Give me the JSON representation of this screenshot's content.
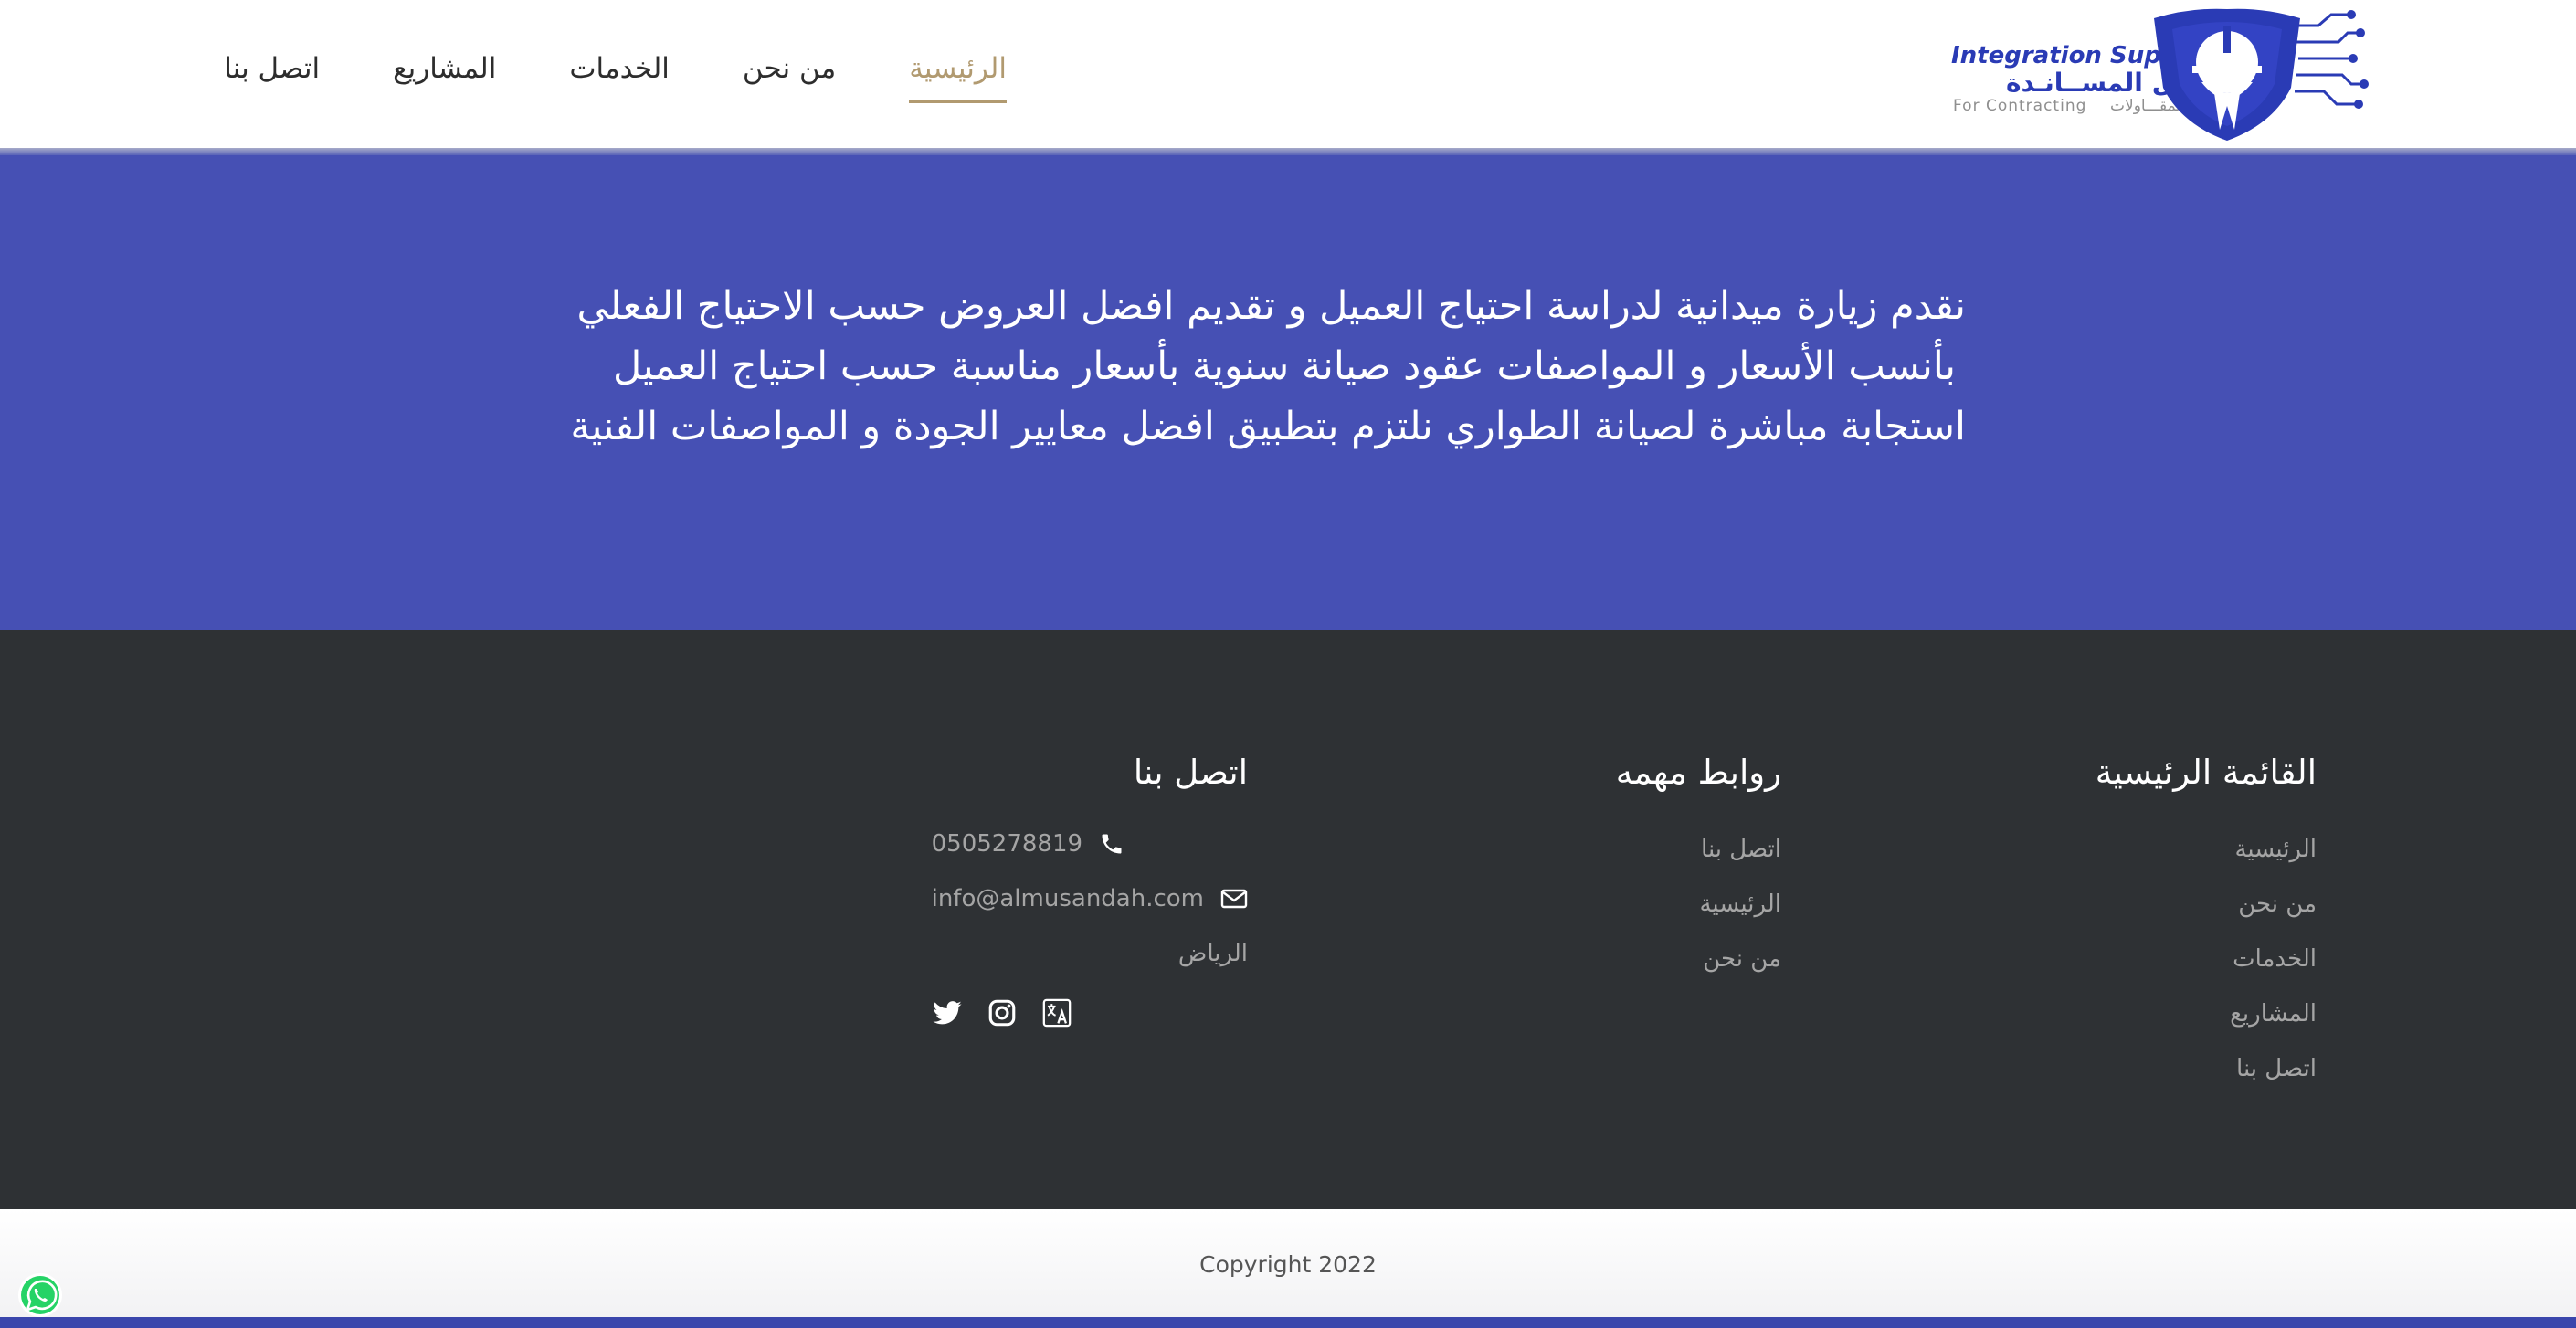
{
  "colors": {
    "header_bg": "#ffffff",
    "nav_active": "#b19a70",
    "hero_bg": "#4650b4",
    "footer_bg": "#2e3134",
    "brand_blue": "#2a3bb5"
  },
  "logo": {
    "text_en": "Integration Supports",
    "text_ar": "تكـامـل المســانـدة",
    "text_sub_en": "For Contracting",
    "text_sub_ar": "للمقـــاولات",
    "icon": "helmet-shield-circuit-logo"
  },
  "nav": {
    "items": [
      {
        "label": "الرئيسية",
        "active": true
      },
      {
        "label": "من نحن",
        "active": false
      },
      {
        "label": "الخدمات",
        "active": false
      },
      {
        "label": "المشاريع",
        "active": false
      },
      {
        "label": "اتصل بنا",
        "active": false
      }
    ]
  },
  "hero": {
    "lines": [
      "نقدم زيارة ميدانية لدراسة احتياج العميل و تقديم افضل العروض حسب الاحتياج الفعلي",
      "بأنسب الأسعار و المواصفات عقود صيانة سنوية بأسعار مناسبة حسب احتياج العميل",
      "استجابة مباشرة لصيانة الطواري نلتزم بتطبيق افضل معايير الجودة و المواصفات الفنية"
    ]
  },
  "footer": {
    "main_menu": {
      "title": "القائمة الرئيسية",
      "items": [
        "الرئيسية",
        "من نحن",
        "الخدمات",
        "المشاريع",
        "اتصل بنا"
      ]
    },
    "important_links": {
      "title": "روابط مهمه",
      "items": [
        "اتصل بنا",
        "الرئيسية",
        "من نحن"
      ]
    },
    "contact": {
      "title": "اتصل بنا",
      "phone": "0505278819",
      "phone_icon": "phone-icon",
      "email": "info@almusandah.com",
      "email_icon": "envelope-icon",
      "city": "الرياض",
      "social_icons": [
        "twitter-icon",
        "instagram-icon",
        "translate-icon"
      ]
    }
  },
  "bottom": {
    "copyright": "Copyright 2022",
    "whatsapp_icon": "whatsapp-icon"
  }
}
